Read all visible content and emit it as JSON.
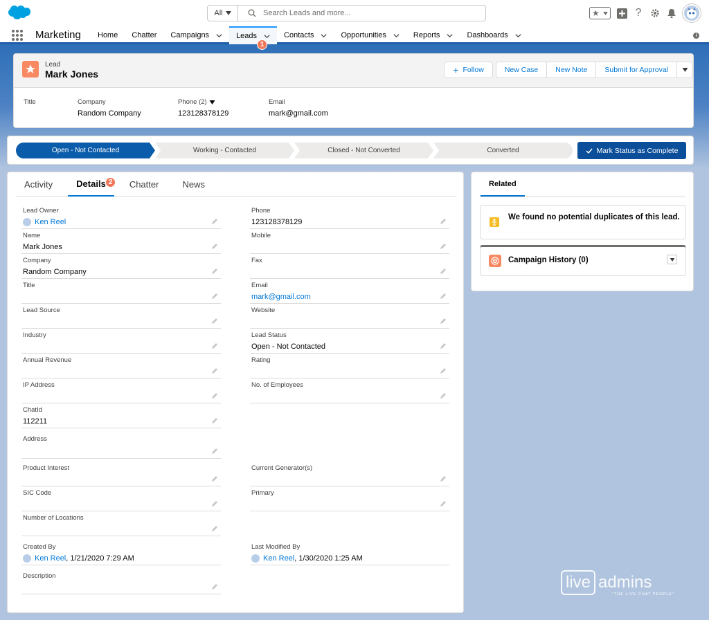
{
  "header": {
    "search_scope": "All",
    "search_placeholder": "Search Leads and more..."
  },
  "nav": {
    "app_name": "Marketing",
    "items": [
      {
        "label": "Home",
        "dropdown": false
      },
      {
        "label": "Chatter",
        "dropdown": false
      },
      {
        "label": "Campaigns",
        "dropdown": true
      },
      {
        "label": "Leads",
        "dropdown": true,
        "active": true
      },
      {
        "label": "Contacts",
        "dropdown": true
      },
      {
        "label": "Opportunities",
        "dropdown": true
      },
      {
        "label": "Reports",
        "dropdown": true
      },
      {
        "label": "Dashboards",
        "dropdown": true
      }
    ],
    "leads_badge": "1"
  },
  "record": {
    "object_type": "Lead",
    "name": "Mark Jones",
    "actions": {
      "follow": "Follow",
      "new_case": "New Case",
      "new_note": "New Note",
      "submit": "Submit for Approval"
    },
    "highlights": [
      {
        "label": "Title",
        "value": ""
      },
      {
        "label": "Company",
        "value": "Random Company"
      },
      {
        "label": "Phone (2)",
        "value": "123128378129"
      },
      {
        "label": "Email",
        "value": "mark@gmail.com"
      }
    ]
  },
  "path": {
    "steps": [
      "Open - Not Contacted",
      "Working - Contacted",
      "Closed - Not Converted",
      "Converted"
    ],
    "mark_button": "Mark Status as Complete"
  },
  "details": {
    "tabs": [
      "Activity",
      "Details",
      "Chatter",
      "News"
    ],
    "details_badge": "2",
    "left": [
      {
        "label": "Lead Owner",
        "value": "Ken Reel"
      },
      {
        "label": "Name",
        "value": "Mark Jones"
      },
      {
        "label": "Company",
        "value": "Random Company"
      },
      {
        "label": "Title",
        "value": ""
      },
      {
        "label": "Lead Source",
        "value": ""
      },
      {
        "label": "Industry",
        "value": ""
      },
      {
        "label": "Annual Revenue",
        "value": ""
      },
      {
        "label": "IP Address",
        "value": ""
      },
      {
        "label": "ChatId",
        "value": "112211"
      },
      {
        "label": "Address",
        "value": ""
      },
      {
        "label": "Product Interest",
        "value": ""
      },
      {
        "label": "SIC Code",
        "value": ""
      },
      {
        "label": "Number of Locations",
        "value": ""
      },
      {
        "label": "Created By",
        "value": "Ken Reel",
        "date": ", 1/21/2020 7:29 AM"
      },
      {
        "label": "Description",
        "value": ""
      }
    ],
    "right": [
      {
        "label": "Phone",
        "value": "123128378129"
      },
      {
        "label": "Mobile",
        "value": ""
      },
      {
        "label": "Fax",
        "value": ""
      },
      {
        "label": "Email",
        "value": "mark@gmail.com"
      },
      {
        "label": "Website",
        "value": ""
      },
      {
        "label": "Lead Status",
        "value": "Open - Not Contacted"
      },
      {
        "label": "Rating",
        "value": ""
      },
      {
        "label": "No. of Employees",
        "value": ""
      },
      {
        "label": "Current Generator(s)",
        "value": ""
      },
      {
        "label": "Primary",
        "value": ""
      },
      {
        "label": "Last Modified By",
        "value": "Ken Reel",
        "date": ", 1/30/2020 1:25 AM"
      }
    ]
  },
  "related": {
    "tab": "Related",
    "duplicates": "We found no potential duplicates of this lead.",
    "campaign_history": "Campaign History (0)"
  },
  "watermark": {
    "live": "live",
    "admins": "admins",
    "tagline": "\"THE LIVE CHAT PEOPLE\""
  },
  "colors": {
    "brand": "#1f5fa8",
    "link": "#0176d3",
    "path_current": "#0b5cab",
    "mark_button": "#0b4f9b",
    "lead_icon": "#f88962",
    "badge": "#f0785a"
  }
}
